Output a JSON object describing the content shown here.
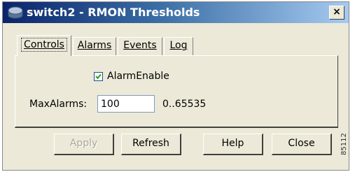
{
  "window": {
    "title": "switch2 - RMON Thresholds",
    "close_glyph": "×",
    "app_icon": "switch-device-icon"
  },
  "tabs": [
    {
      "label": "Controls",
      "active": true
    },
    {
      "label": "Alarms",
      "active": false
    },
    {
      "label": "Events",
      "active": false
    },
    {
      "label": "Log",
      "active": false
    }
  ],
  "controls": {
    "alarm_enable": {
      "label": "AlarmEnable",
      "checked": true
    },
    "max_alarms": {
      "label": "MaxAlarms:",
      "value": "100",
      "range": "0..65535"
    }
  },
  "buttons": {
    "apply": "Apply",
    "refresh": "Refresh",
    "help": "Help",
    "close": "Close"
  },
  "side_text": "85112",
  "colors": {
    "titlebar_start": "#0a246a",
    "titlebar_end": "#a6caf0",
    "face": "#ece9d8"
  }
}
